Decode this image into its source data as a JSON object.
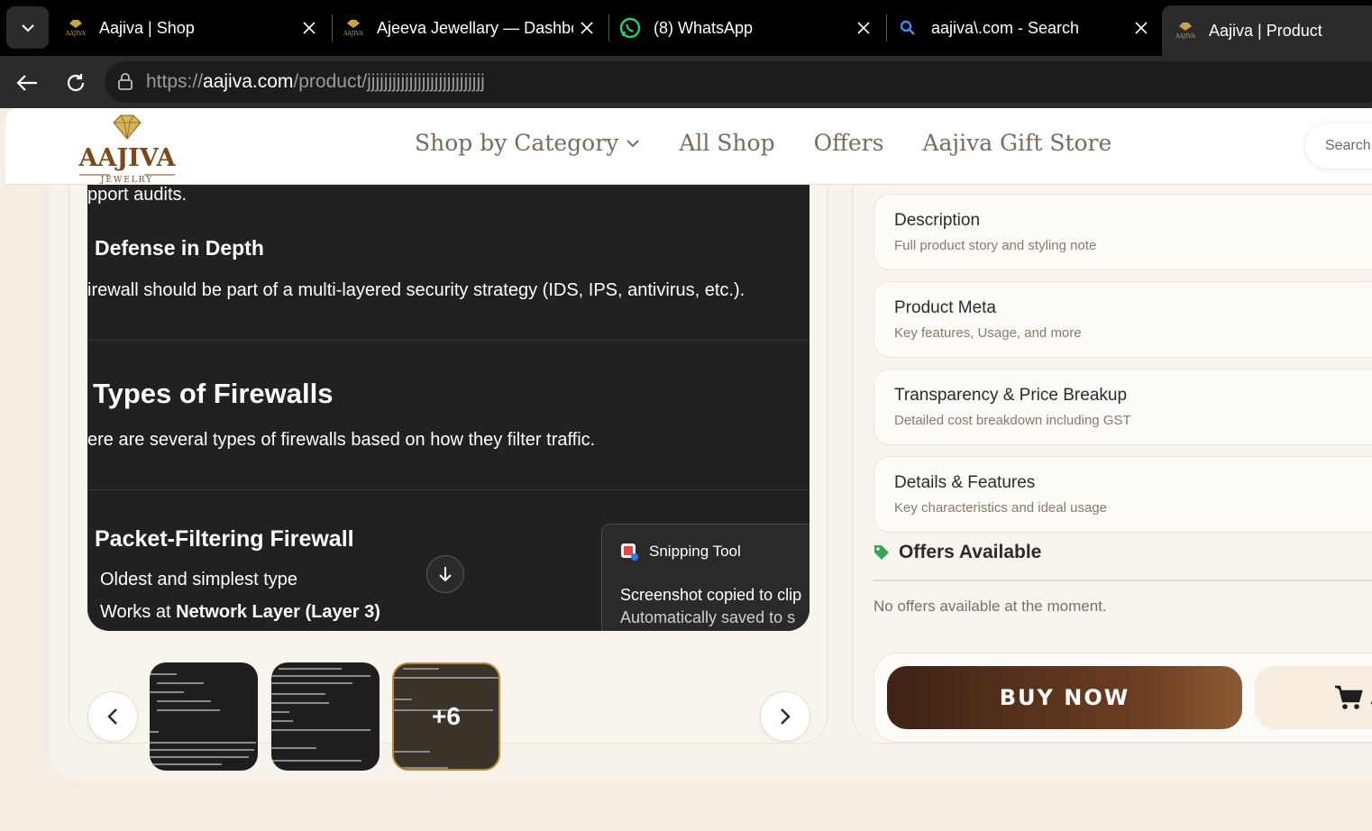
{
  "browser": {
    "tabs": [
      {
        "title": "Aajiva | Shop",
        "icon": "aajiva-favicon"
      },
      {
        "title": "Ajeeva Jewellary — Dashboard",
        "icon": "aajiva-favicon"
      },
      {
        "title": "(8) WhatsApp",
        "icon": "whatsapp-icon"
      },
      {
        "title": "aajiva\\.com - Search",
        "icon": "search-icon"
      },
      {
        "title": "Aajiva | Product",
        "icon": "aajiva-favicon"
      }
    ],
    "url": {
      "scheme": "https://",
      "domain": "aajiva.com",
      "path": "/product/",
      "slug": "jjjjjjjjjjjjjjjjjjjjjjjjjjjj"
    }
  },
  "header": {
    "logo_text": "AAJIVA",
    "logo_subtext": "JEWELRY",
    "nav": [
      "Shop by Category",
      "All Shop",
      "Offers",
      "Aajiva Gift Store"
    ],
    "search_placeholder": "Search..."
  },
  "gallery": {
    "slide": {
      "line_audits": "pport audits.",
      "h_defense": "Defense in Depth",
      "line_defense": "irewall should be part of a multi-layered security strategy (IDS, IPS, antivirus, etc.).",
      "h_types": "Types of Firewalls",
      "line_types": "ere are several types of firewalls based on how they filter traffic.",
      "h_packet": "Packet-Filtering Firewall",
      "line_oldest": "Oldest and simplest type",
      "line_works_prefix": "Works at ",
      "line_works_bold": "Network Layer (Layer 3)"
    },
    "snipping": {
      "title": "Snipping Tool",
      "msg1": "Screenshot copied to clip",
      "msg2": "Automatically saved to s"
    },
    "more_count": "+6"
  },
  "sidebar": {
    "accordions": [
      {
        "title": "Description",
        "subtitle": "Full product story and styling note"
      },
      {
        "title": "Product Meta",
        "subtitle": "Key features, Usage, and more"
      },
      {
        "title": "Transparency & Price Breakup",
        "subtitle": "Detailed cost breakdown including GST"
      },
      {
        "title": "Details & Features",
        "subtitle": "Key characteristics and ideal usage"
      }
    ],
    "offers_title": "Offers Available",
    "no_offers": "No offers available at the moment.",
    "buy_now": "BUY NOW",
    "add_to_cart_partial": "A"
  },
  "colors": {
    "accent_brown": "#5a3420",
    "gold": "#b48a3a",
    "offer_tag": "#3aa55a"
  }
}
